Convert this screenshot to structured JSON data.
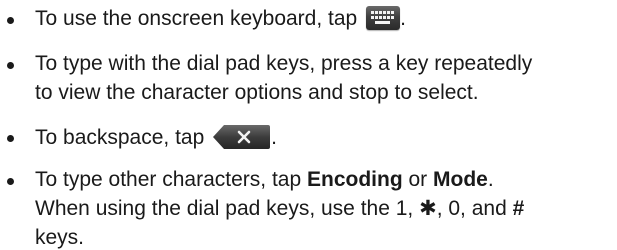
{
  "items": [
    {
      "text_before_icon": "To use the onscreen keyboard, tap",
      "icon": "keyboard-icon",
      "text_after_icon": "."
    },
    {
      "line1": "To type with the dial pad keys, press a key repeatedly",
      "line2": "to view the character options and stop to select."
    },
    {
      "text_before_icon": "To backspace, tap",
      "icon": "backspace-icon",
      "text_after_icon": "."
    },
    {
      "line1_before": "To type other characters, tap",
      "line1_bold_1": "Encoding",
      "line1_mid": "or",
      "line1_bold_2": "Mode",
      "line1_end": ".",
      "line2_before": "When using the dial pad keys, use the 1,",
      "line2_star": "✱",
      "line2_mid": ", 0, and",
      "line2_hash": "#",
      "line3": "keys."
    }
  ],
  "colors": {
    "text": "#1a1a1a",
    "icon_dark": "#2a2a2a"
  }
}
